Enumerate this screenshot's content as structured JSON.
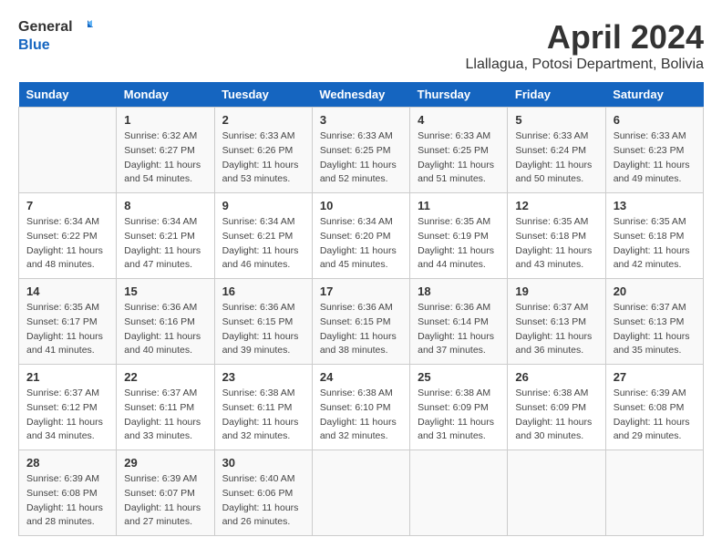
{
  "logo": {
    "line1": "General",
    "line2": "Blue"
  },
  "title": "April 2024",
  "subtitle": "Llallagua, Potosi Department, Bolivia",
  "weekdays": [
    "Sunday",
    "Monday",
    "Tuesday",
    "Wednesday",
    "Thursday",
    "Friday",
    "Saturday"
  ],
  "weeks": [
    [
      {
        "day": "",
        "info": ""
      },
      {
        "day": "1",
        "info": "Sunrise: 6:32 AM\nSunset: 6:27 PM\nDaylight: 11 hours\nand 54 minutes."
      },
      {
        "day": "2",
        "info": "Sunrise: 6:33 AM\nSunset: 6:26 PM\nDaylight: 11 hours\nand 53 minutes."
      },
      {
        "day": "3",
        "info": "Sunrise: 6:33 AM\nSunset: 6:25 PM\nDaylight: 11 hours\nand 52 minutes."
      },
      {
        "day": "4",
        "info": "Sunrise: 6:33 AM\nSunset: 6:25 PM\nDaylight: 11 hours\nand 51 minutes."
      },
      {
        "day": "5",
        "info": "Sunrise: 6:33 AM\nSunset: 6:24 PM\nDaylight: 11 hours\nand 50 minutes."
      },
      {
        "day": "6",
        "info": "Sunrise: 6:33 AM\nSunset: 6:23 PM\nDaylight: 11 hours\nand 49 minutes."
      }
    ],
    [
      {
        "day": "7",
        "info": "Sunrise: 6:34 AM\nSunset: 6:22 PM\nDaylight: 11 hours\nand 48 minutes."
      },
      {
        "day": "8",
        "info": "Sunrise: 6:34 AM\nSunset: 6:21 PM\nDaylight: 11 hours\nand 47 minutes."
      },
      {
        "day": "9",
        "info": "Sunrise: 6:34 AM\nSunset: 6:21 PM\nDaylight: 11 hours\nand 46 minutes."
      },
      {
        "day": "10",
        "info": "Sunrise: 6:34 AM\nSunset: 6:20 PM\nDaylight: 11 hours\nand 45 minutes."
      },
      {
        "day": "11",
        "info": "Sunrise: 6:35 AM\nSunset: 6:19 PM\nDaylight: 11 hours\nand 44 minutes."
      },
      {
        "day": "12",
        "info": "Sunrise: 6:35 AM\nSunset: 6:18 PM\nDaylight: 11 hours\nand 43 minutes."
      },
      {
        "day": "13",
        "info": "Sunrise: 6:35 AM\nSunset: 6:18 PM\nDaylight: 11 hours\nand 42 minutes."
      }
    ],
    [
      {
        "day": "14",
        "info": "Sunrise: 6:35 AM\nSunset: 6:17 PM\nDaylight: 11 hours\nand 41 minutes."
      },
      {
        "day": "15",
        "info": "Sunrise: 6:36 AM\nSunset: 6:16 PM\nDaylight: 11 hours\nand 40 minutes."
      },
      {
        "day": "16",
        "info": "Sunrise: 6:36 AM\nSunset: 6:15 PM\nDaylight: 11 hours\nand 39 minutes."
      },
      {
        "day": "17",
        "info": "Sunrise: 6:36 AM\nSunset: 6:15 PM\nDaylight: 11 hours\nand 38 minutes."
      },
      {
        "day": "18",
        "info": "Sunrise: 6:36 AM\nSunset: 6:14 PM\nDaylight: 11 hours\nand 37 minutes."
      },
      {
        "day": "19",
        "info": "Sunrise: 6:37 AM\nSunset: 6:13 PM\nDaylight: 11 hours\nand 36 minutes."
      },
      {
        "day": "20",
        "info": "Sunrise: 6:37 AM\nSunset: 6:13 PM\nDaylight: 11 hours\nand 35 minutes."
      }
    ],
    [
      {
        "day": "21",
        "info": "Sunrise: 6:37 AM\nSunset: 6:12 PM\nDaylight: 11 hours\nand 34 minutes."
      },
      {
        "day": "22",
        "info": "Sunrise: 6:37 AM\nSunset: 6:11 PM\nDaylight: 11 hours\nand 33 minutes."
      },
      {
        "day": "23",
        "info": "Sunrise: 6:38 AM\nSunset: 6:11 PM\nDaylight: 11 hours\nand 32 minutes."
      },
      {
        "day": "24",
        "info": "Sunrise: 6:38 AM\nSunset: 6:10 PM\nDaylight: 11 hours\nand 32 minutes."
      },
      {
        "day": "25",
        "info": "Sunrise: 6:38 AM\nSunset: 6:09 PM\nDaylight: 11 hours\nand 31 minutes."
      },
      {
        "day": "26",
        "info": "Sunrise: 6:38 AM\nSunset: 6:09 PM\nDaylight: 11 hours\nand 30 minutes."
      },
      {
        "day": "27",
        "info": "Sunrise: 6:39 AM\nSunset: 6:08 PM\nDaylight: 11 hours\nand 29 minutes."
      }
    ],
    [
      {
        "day": "28",
        "info": "Sunrise: 6:39 AM\nSunset: 6:08 PM\nDaylight: 11 hours\nand 28 minutes."
      },
      {
        "day": "29",
        "info": "Sunrise: 6:39 AM\nSunset: 6:07 PM\nDaylight: 11 hours\nand 27 minutes."
      },
      {
        "day": "30",
        "info": "Sunrise: 6:40 AM\nSunset: 6:06 PM\nDaylight: 11 hours\nand 26 minutes."
      },
      {
        "day": "",
        "info": ""
      },
      {
        "day": "",
        "info": ""
      },
      {
        "day": "",
        "info": ""
      },
      {
        "day": "",
        "info": ""
      }
    ]
  ]
}
